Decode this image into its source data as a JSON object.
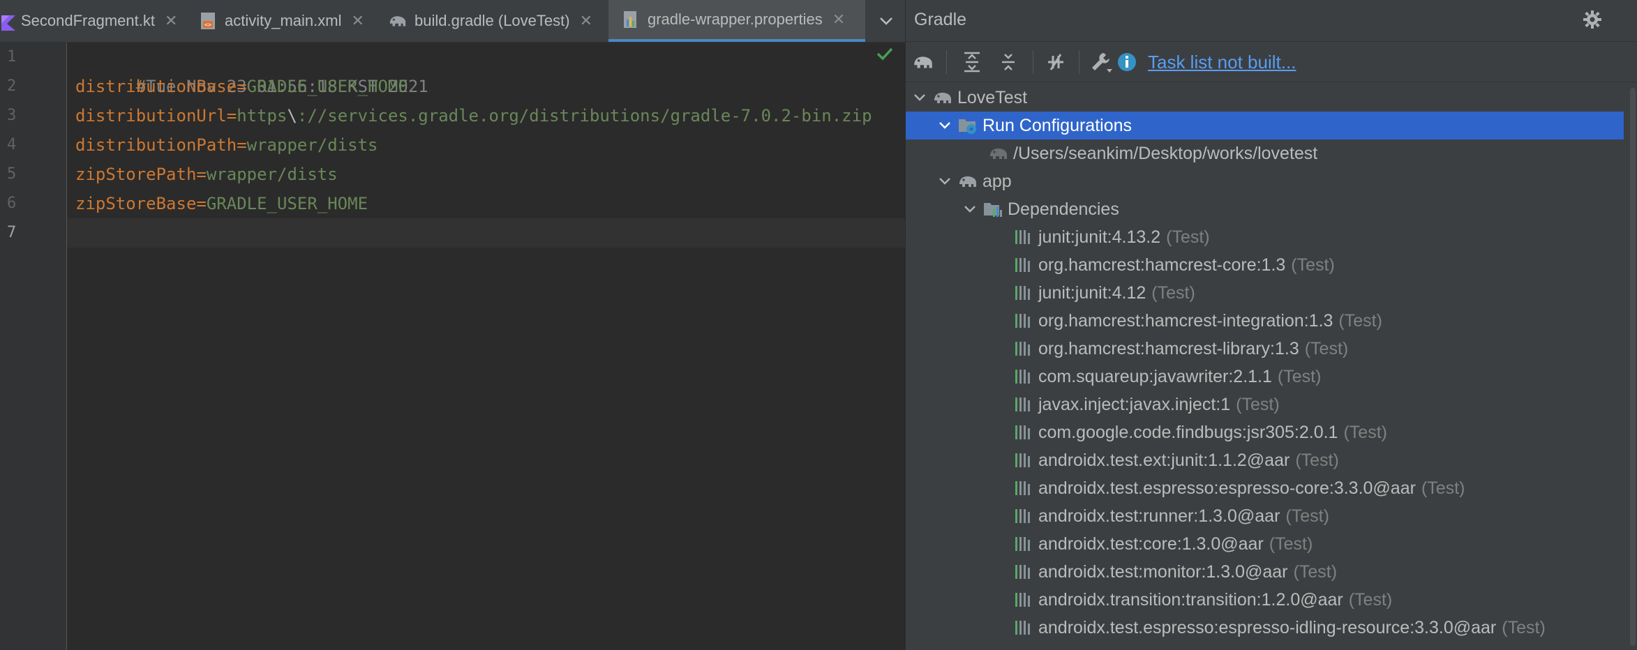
{
  "editor": {
    "tabs": [
      {
        "label": "SecondFragment.kt",
        "icon": "kotlin-file-icon",
        "active": false
      },
      {
        "label": "activity_main.xml",
        "icon": "xml-layout-icon",
        "active": false
      },
      {
        "label": "build.gradle (LoveTest)",
        "icon": "gradle-elephant-icon",
        "active": false
      },
      {
        "label": "gradle-wrapper.properties",
        "icon": "properties-file-icon",
        "active": true
      }
    ],
    "line_numbers": [
      "1",
      "2",
      "3",
      "4",
      "5",
      "6",
      "7"
    ],
    "lines": [
      {
        "comment": "#Tue Nov 23 01:56:18 KST 2021"
      },
      {
        "key": "distributionBase",
        "eq": "=",
        "value": "GRADLE_USER_HOME"
      },
      {
        "key": "distributionUrl",
        "eq": "=",
        "value_a": "https",
        "esc": "\\",
        "value_b": "://services.gradle.org/distributions/gradle-7.0.2-bin.zip"
      },
      {
        "key": "distributionPath",
        "eq": "=",
        "value": "wrapper/dists"
      },
      {
        "key": "zipStorePath",
        "eq": "=",
        "value": "wrapper/dists"
      },
      {
        "key": "zipStoreBase",
        "eq": "=",
        "value": "GRADLE_USER_HOME"
      }
    ],
    "colors": {
      "keyword": "#cc7832",
      "string": "#6a8759",
      "comment": "#808080",
      "ok": "#499c54"
    }
  },
  "gradle": {
    "title": "Gradle",
    "toolbar": {
      "icons": [
        "gradle-elephant-icon",
        "expand-all-icon",
        "collapse-all-icon",
        "toggle-offline-icon",
        "build-tools-icon",
        "info-icon"
      ],
      "task_list_link": "Task list not built..."
    },
    "tree": [
      {
        "label": "LoveTest",
        "level": 0,
        "icon": "gradle-elephant-icon",
        "expanded": true
      },
      {
        "label": "Run Configurations",
        "level": 1,
        "icon": "run-config-folder-icon",
        "expanded": true,
        "selected": true
      },
      {
        "label": "/Users/seankim/Desktop/works/lovetest",
        "level": 2,
        "icon": "gradle-elephant-icon"
      },
      {
        "label": "app",
        "level": 1,
        "icon": "gradle-elephant-icon",
        "expanded": true
      },
      {
        "label": "Dependencies",
        "level": 2,
        "icon": "dependencies-folder-icon",
        "expanded": true
      },
      {
        "label": "junit:junit:4.13.2",
        "scope": "(Test)",
        "level": 3,
        "icon": "library-icon"
      },
      {
        "label": "org.hamcrest:hamcrest-core:1.3",
        "scope": "(Test)",
        "level": 3,
        "icon": "library-icon"
      },
      {
        "label": "junit:junit:4.12",
        "scope": "(Test)",
        "level": 3,
        "icon": "library-icon"
      },
      {
        "label": "org.hamcrest:hamcrest-integration:1.3",
        "scope": "(Test)",
        "level": 3,
        "icon": "library-icon"
      },
      {
        "label": "org.hamcrest:hamcrest-library:1.3",
        "scope": "(Test)",
        "level": 3,
        "icon": "library-icon"
      },
      {
        "label": "com.squareup:javawriter:2.1.1",
        "scope": "(Test)",
        "level": 3,
        "icon": "library-icon"
      },
      {
        "label": "javax.inject:javax.inject:1",
        "scope": "(Test)",
        "level": 3,
        "icon": "library-icon"
      },
      {
        "label": "com.google.code.findbugs:jsr305:2.0.1",
        "scope": "(Test)",
        "level": 3,
        "icon": "library-icon"
      },
      {
        "label": "androidx.test.ext:junit:1.1.2@aar",
        "scope": "(Test)",
        "level": 3,
        "icon": "library-icon"
      },
      {
        "label": "androidx.test.espresso:espresso-core:3.3.0@aar",
        "scope": "(Test)",
        "level": 3,
        "icon": "library-icon"
      },
      {
        "label": "androidx.test:runner:1.3.0@aar",
        "scope": "(Test)",
        "level": 3,
        "icon": "library-icon"
      },
      {
        "label": "androidx.test:core:1.3.0@aar",
        "scope": "(Test)",
        "level": 3,
        "icon": "library-icon"
      },
      {
        "label": "androidx.test:monitor:1.3.0@aar",
        "scope": "(Test)",
        "level": 3,
        "icon": "library-icon"
      },
      {
        "label": "androidx.transition:transition:1.2.0@aar",
        "scope": "(Test)",
        "level": 3,
        "icon": "library-icon"
      },
      {
        "label": "androidx.test.espresso:espresso-idling-resource:3.3.0@aar",
        "scope": "(Test)",
        "level": 3,
        "icon": "library-icon"
      }
    ],
    "colors": {
      "selection": "#2f65ca",
      "link": "#589df6",
      "elephant": "#9aa0a6"
    }
  }
}
